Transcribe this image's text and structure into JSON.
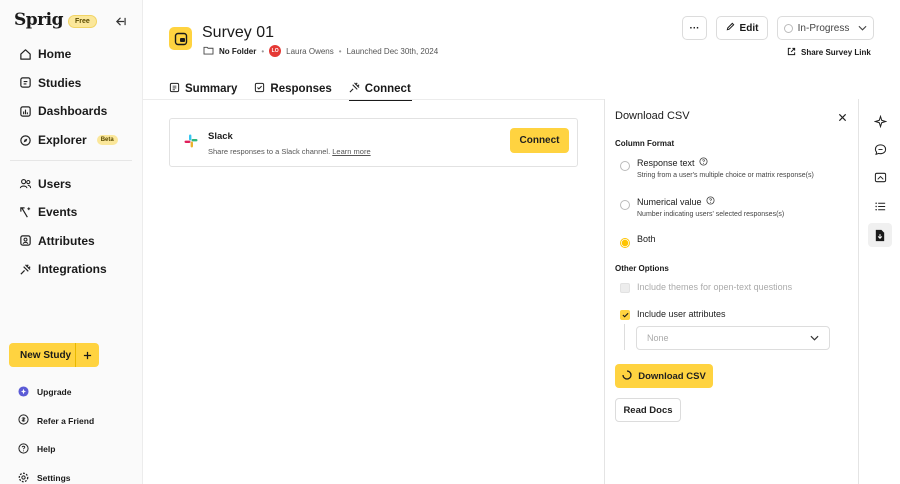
{
  "app": {
    "logo": "Sprig",
    "plan_badge": "Free"
  },
  "sidebar": {
    "items": [
      {
        "label": "Home",
        "icon": "home-icon"
      },
      {
        "label": "Studies",
        "icon": "studies-icon"
      },
      {
        "label": "Dashboards",
        "icon": "dashboards-icon"
      },
      {
        "label": "Explorer",
        "icon": "explorer-icon",
        "badge": "Beta"
      }
    ],
    "items2": [
      {
        "label": "Users",
        "icon": "users-icon"
      },
      {
        "label": "Events",
        "icon": "events-icon"
      },
      {
        "label": "Attributes",
        "icon": "attributes-icon"
      },
      {
        "label": "Integrations",
        "icon": "integrations-icon"
      }
    ],
    "new_study": "New Study",
    "footer": [
      {
        "label": "Upgrade",
        "icon": "upgrade-icon"
      },
      {
        "label": "Refer a Friend",
        "icon": "refer-icon"
      },
      {
        "label": "Help",
        "icon": "help-icon"
      },
      {
        "label": "Settings",
        "icon": "settings-icon"
      }
    ]
  },
  "header": {
    "title": "Survey 01",
    "folder": "No Folder",
    "owner_initials": "LO",
    "owner": "Laura Owens",
    "launched": "Launched Dec 30th, 2024",
    "more": "···",
    "edit": "Edit",
    "status": "In-Progress",
    "share": "Share Survey Link"
  },
  "tabs": [
    {
      "label": "Summary",
      "active": false
    },
    {
      "label": "Responses",
      "active": false
    },
    {
      "label": "Connect",
      "active": true
    }
  ],
  "slack": {
    "title": "Slack",
    "desc": "Share responses to a Slack channel.",
    "learn_more": "Learn more",
    "connect": "Connect"
  },
  "csv_panel": {
    "title": "Download CSV",
    "column_format_label": "Column Format",
    "options": [
      {
        "label": "Response text",
        "desc": "String from a user's multiple choice or matrix response(s)",
        "selected": false
      },
      {
        "label": "Numerical value",
        "desc": "Number indicating users' selected responses(s)",
        "selected": false
      },
      {
        "label": "Both",
        "desc": "",
        "selected": true
      }
    ],
    "other_options_label": "Other Options",
    "include_themes": "Include themes for open-text questions",
    "include_attrs": "Include user attributes",
    "attr_placeholder": "None",
    "download_button": "Download CSV",
    "read_docs": "Read Docs"
  },
  "colors": {
    "accent": "#ffd340",
    "avatar": "#e53935"
  }
}
